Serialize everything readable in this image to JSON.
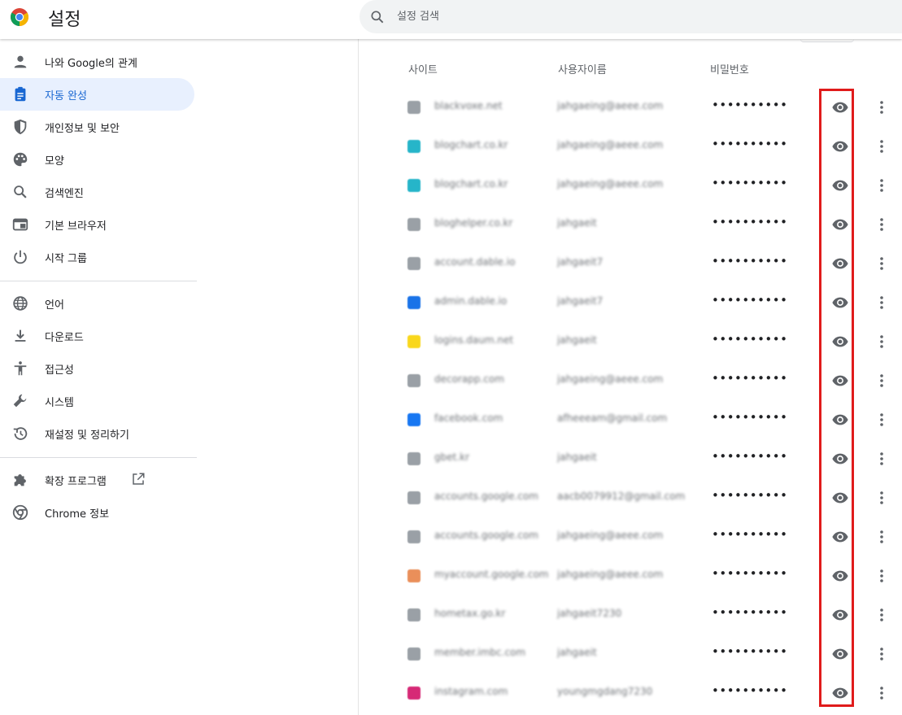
{
  "app": {
    "title": "설정"
  },
  "search": {
    "placeholder": "설정 검색"
  },
  "sidebar": {
    "items": [
      {
        "label": "나와 Google의 관계",
        "icon": "person-icon"
      },
      {
        "label": "자동 완성",
        "icon": "clipboard-icon",
        "active": true
      },
      {
        "label": "개인정보 및 보안",
        "icon": "shield-icon"
      },
      {
        "label": "모양",
        "icon": "palette-icon"
      },
      {
        "label": "검색엔진",
        "icon": "search-icon"
      },
      {
        "label": "기본 브라우저",
        "icon": "browser-icon"
      },
      {
        "label": "시작 그룹",
        "icon": "power-icon"
      },
      {
        "label": "언어",
        "icon": "globe-icon"
      },
      {
        "label": "다운로드",
        "icon": "download-icon"
      },
      {
        "label": "접근성",
        "icon": "accessibility-icon"
      },
      {
        "label": "시스템",
        "icon": "wrench-icon"
      },
      {
        "label": "재설정 및 정리하기",
        "icon": "restore-icon"
      },
      {
        "label": "확장 프로그램",
        "icon": "puzzle-icon"
      },
      {
        "label": "Chrome 정보",
        "icon": "chrome-icon"
      }
    ]
  },
  "table": {
    "headers": {
      "site": "사이트",
      "username": "사용자이름",
      "password": "비밀번호"
    },
    "password_mask": "••••••••••",
    "rows": [
      {
        "site": "blackvoxe.net",
        "username": "jahgaeing@aeee.com",
        "icon_color": "#9aa0a6"
      },
      {
        "site": "blogchart.co.kr",
        "username": "jahgaeing@aeee.com",
        "icon_color": "#26b5c9"
      },
      {
        "site": "blogchart.co.kr",
        "username": "jahgaeing@aeee.com",
        "icon_color": "#26b5c9"
      },
      {
        "site": "bloghelper.co.kr",
        "username": "jahgaeit",
        "icon_color": "#9aa0a6"
      },
      {
        "site": "account.dable.io",
        "username": "jahgaeit7",
        "icon_color": "#9aa0a6"
      },
      {
        "site": "admin.dable.io",
        "username": "jahgaeit7",
        "icon_color": "#1a73e8"
      },
      {
        "site": "logins.daum.net",
        "username": "jahgaeit",
        "icon_color": "#f9d71c"
      },
      {
        "site": "decorapp.com",
        "username": "jahgaeing@aeee.com",
        "icon_color": "#9aa0a6"
      },
      {
        "site": "facebook.com",
        "username": "afheeeam@gmail.com",
        "icon_color": "#1877f2"
      },
      {
        "site": "gbet.kr",
        "username": "jahgaeit",
        "icon_color": "#9aa0a6"
      },
      {
        "site": "accounts.google.com",
        "username": "aacb0079912@gmail.com",
        "icon_color": "#9aa0a6"
      },
      {
        "site": "accounts.google.com",
        "username": "jahgaeing@aeee.com",
        "icon_color": "#9aa0a6"
      },
      {
        "site": "myaccount.google.com",
        "username": "jahgaeing@aeee.com",
        "icon_color": "#ea8f5a"
      },
      {
        "site": "hometax.go.kr",
        "username": "jahgaeit7230",
        "icon_color": "#9aa0a6"
      },
      {
        "site": "member.imbc.com",
        "username": "jahgaeit",
        "icon_color": "#9aa0a6"
      },
      {
        "site": "instagram.com",
        "username": "youngmgdang7230",
        "icon_color": "#d62976"
      }
    ]
  },
  "colors": {
    "accent": "#1967d2",
    "active_bg": "#e8f0fe",
    "highlight": "#e01b1b"
  }
}
